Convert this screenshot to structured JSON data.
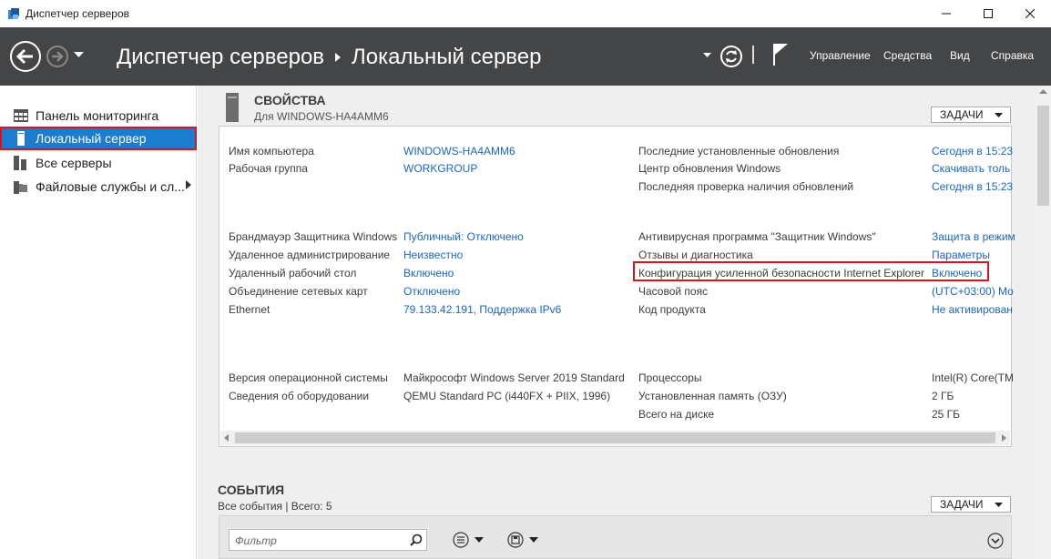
{
  "window": {
    "title": "Диспетчер серверов"
  },
  "header": {
    "breadcrumb_root": "Диспетчер серверов",
    "breadcrumb_current": "Локальный сервер",
    "menu": [
      "Управление",
      "Средства",
      "Вид",
      "Справка"
    ]
  },
  "sidebar": {
    "items": [
      {
        "label": "Панель мониторинга",
        "icon": "dashboard-icon",
        "active": false
      },
      {
        "label": "Локальный сервер",
        "icon": "server-icon",
        "active": true
      },
      {
        "label": "Все серверы",
        "icon": "servers-icon",
        "active": false
      },
      {
        "label": "Файловые службы и сл...",
        "icon": "file-services-icon",
        "active": false
      }
    ]
  },
  "properties": {
    "title": "СВОЙСТВА",
    "subtitle": "Для WINDOWS-HA4AMM6",
    "tasks_label": "ЗАДАЧИ",
    "left": [
      {
        "label": "Имя компьютера",
        "value": "WINDOWS-HA4AMM6",
        "link": true
      },
      {
        "label": "Рабочая группа",
        "value": "WORKGROUP",
        "link": true
      },
      {
        "label": "Брандмауэр Защитника Windows",
        "value": "Публичный: Отключено",
        "link": true
      },
      {
        "label": "Удаленное администрирование",
        "value": "Неизвестно",
        "link": true
      },
      {
        "label": "Удаленный рабочий стол",
        "value": "Включено",
        "link": true
      },
      {
        "label": "Объединение сетевых карт",
        "value": "Отключено",
        "link": true
      },
      {
        "label": "Ethernet",
        "value": "79.133.42.191, Поддержка IPv6",
        "link": true
      },
      {
        "label": "Версия операционной системы",
        "value": "Майкрософт Windows Server 2019 Standard",
        "link": false
      },
      {
        "label": "Сведения об оборудовании",
        "value": "QEMU Standard PC (i440FX + PIIX, 1996)",
        "link": false
      }
    ],
    "right": [
      {
        "label": "Последние установленные обновления",
        "value": "Сегодня в 15:23",
        "link": true
      },
      {
        "label": "Центр обновления Windows",
        "value": "Скачивать толь",
        "link": true
      },
      {
        "label": "Последняя проверка наличия обновлений",
        "value": "Сегодня в 15:23",
        "link": true
      },
      {
        "label": "Антивирусная программа \"Защитник Windows\"",
        "value": "Защита в режим",
        "link": true
      },
      {
        "label": "Отзывы и диагностика",
        "value": "Параметры",
        "link": true
      },
      {
        "label": "Конфигурация усиленной безопасности Internet Explorer",
        "value": "Включено",
        "link": true
      },
      {
        "label": "Часовой пояс",
        "value": "(UTC+03:00) Мо",
        "link": true
      },
      {
        "label": "Код продукта",
        "value": "Не активирован",
        "link": true
      },
      {
        "label": "Процессоры",
        "value": "Intel(R) Core(TM",
        "link": false
      },
      {
        "label": "Установленная память (ОЗУ)",
        "value": "2 ГБ",
        "link": false
      },
      {
        "label": "Всего на диске",
        "value": "25 ГБ",
        "link": false
      }
    ]
  },
  "events": {
    "title": "СОБЫТИЯ",
    "subtitle": "Все события | Всего: 5",
    "tasks_label": "ЗАДАЧИ",
    "filter_placeholder": "Фильтр"
  },
  "colors": {
    "header_bg": "#444546",
    "active_item": "#1c7ccf",
    "highlight": "#d6151e",
    "link": "#1a66c2"
  }
}
